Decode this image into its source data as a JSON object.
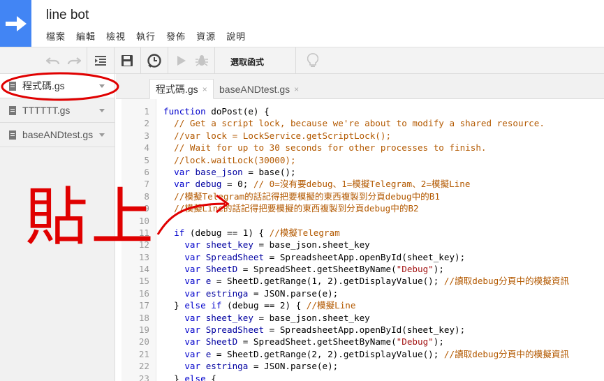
{
  "app": {
    "title": "line bot",
    "menu": [
      "檔案",
      "編輯",
      "檢視",
      "執行",
      "發佈",
      "資源",
      "說明"
    ]
  },
  "toolbar": {
    "function_label": "選取函式"
  },
  "sidebar": {
    "files": [
      {
        "name": "程式碼.gs",
        "active": true
      },
      {
        "name": "TTTTTT.gs",
        "active": false
      },
      {
        "name": "baseANDtest.gs",
        "active": false
      }
    ]
  },
  "tabs": [
    {
      "label": "程式碼.gs",
      "close": "×",
      "active": true
    },
    {
      "label": "baseANDtest.gs",
      "close": "×",
      "active": false
    }
  ],
  "code_lines": [
    {
      "n": "1",
      "text": "function doPost(e) {"
    },
    {
      "n": "2",
      "text": "  // Get a script lock, because we're about to modify a shared resource."
    },
    {
      "n": "3",
      "text": "  //var lock = LockService.getScriptLock();"
    },
    {
      "n": "4",
      "text": "  // Wait for up to 30 seconds for other processes to finish."
    },
    {
      "n": "5",
      "text": "  //lock.waitLock(30000);"
    },
    {
      "n": "6",
      "text": "  var base_json = base();"
    },
    {
      "n": "7",
      "text": "  var debug = 0; // 0=沒有要debug、1=模擬Telegram、2=模擬Line"
    },
    {
      "n": "8",
      "text": "  //模擬Telegram的話記得把要模擬的東西複製到分頁debug中的B1"
    },
    {
      "n": "9",
      "text": "  //模擬Line的話記得把要模擬的東西複製到分頁debug中的B2"
    },
    {
      "n": "10",
      "text": ""
    },
    {
      "n": "11",
      "text": "  if (debug == 1) { //模擬Telegram"
    },
    {
      "n": "12",
      "text": "    var sheet_key = base_json.sheet_key"
    },
    {
      "n": "13",
      "text": "    var SpreadSheet = SpreadsheetApp.openById(sheet_key);"
    },
    {
      "n": "14",
      "text": "    var SheetD = SpreadSheet.getSheetByName(\"Debug\");"
    },
    {
      "n": "15",
      "text": "    var e = SheetD.getRange(1, 2).getDisplayValue(); //讀取debug分頁中的模擬資訊"
    },
    {
      "n": "16",
      "text": "    var estringa = JSON.parse(e);"
    },
    {
      "n": "17",
      "text": "  } else if (debug == 2) { //模擬Line"
    },
    {
      "n": "18",
      "text": "    var sheet_key = base_json.sheet_key"
    },
    {
      "n": "19",
      "text": "    var SpreadSheet = SpreadsheetApp.openById(sheet_key);"
    },
    {
      "n": "20",
      "text": "    var SheetD = SpreadSheet.getSheetByName(\"Debug\");"
    },
    {
      "n": "21",
      "text": "    var e = SheetD.getRange(2, 2).getDisplayValue(); //讀取debug分頁中的模擬資訊"
    },
    {
      "n": "22",
      "text": "    var estringa = JSON.parse(e);"
    },
    {
      "n": "23",
      "text": "  } else {"
    }
  ],
  "annotation": {
    "text": "貼上",
    "color": "#e00000"
  },
  "colors": {
    "logo": "#4285f4",
    "keyword": "#0000cc",
    "comment": "#b35900",
    "string": "#a31515",
    "variable": "#0000a0"
  }
}
